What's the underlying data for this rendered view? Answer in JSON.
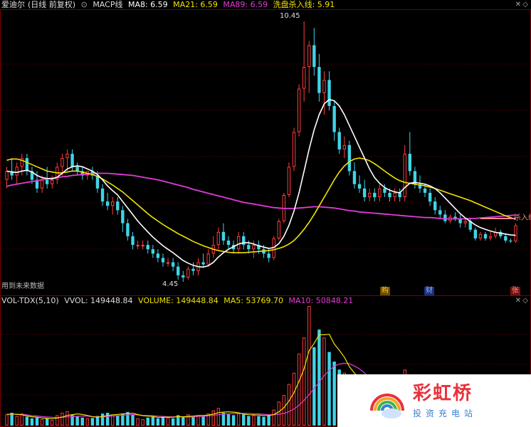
{
  "title": {
    "stock": "爱迪尔",
    "mode": "(日线 前复权)",
    "indicator": "MACP线",
    "ma8_label": "MA8: 6.59",
    "ma21_label": "MA21: 6.59",
    "ma89_label": "MA89: 6.59",
    "wash_label": "洗盘杀入线: 5.91"
  },
  "vol_header": {
    "name": "VOL-TDX(5,10)",
    "vvol": "VVOL: 149448.84",
    "volume": "VOLUME: 149448.84",
    "ma5": "MA5: 53769.70",
    "ma10": "MA10: 50848.21"
  },
  "labels": {
    "high": "10.45",
    "low": "4.45",
    "future_data": "用到未来数据",
    "cross_label": "杀入线"
  },
  "badges": {
    "gou": "购",
    "cai": "财",
    "zhang": "张"
  },
  "watermark": {
    "name": "彩虹桥",
    "sub": "投资充电站"
  },
  "colors": {
    "up": "#ff3c3c",
    "down": "#3fd5e8",
    "ma8": "#ffffff",
    "ma21": "#f2e300",
    "ma89": "#e23bd9",
    "wash": "#ff8a8a",
    "grid": "#7a0000",
    "background": "#000000"
  },
  "chart_data": {
    "type": "candlestick",
    "price_range": [
      4.45,
      10.45
    ],
    "ohlc": [
      [
        6.8,
        7.1,
        6.6,
        7.0
      ],
      [
        7.0,
        7.3,
        6.8,
        6.9
      ],
      [
        6.9,
        7.2,
        6.7,
        7.1
      ],
      [
        7.1,
        7.4,
        6.9,
        7.3
      ],
      [
        7.3,
        7.4,
        6.9,
        7.0
      ],
      [
        7.0,
        7.1,
        6.7,
        6.8
      ],
      [
        6.8,
        7.0,
        6.5,
        6.6
      ],
      [
        6.6,
        6.9,
        6.5,
        6.8
      ],
      [
        6.8,
        7.1,
        6.6,
        6.7
      ],
      [
        6.7,
        6.9,
        6.6,
        6.8
      ],
      [
        6.8,
        7.2,
        6.7,
        7.1
      ],
      [
        7.1,
        7.4,
        6.9,
        7.3
      ],
      [
        7.3,
        7.5,
        7.0,
        7.4
      ],
      [
        7.4,
        7.5,
        7.0,
        7.1
      ],
      [
        7.1,
        7.2,
        6.9,
        7.0
      ],
      [
        7.0,
        7.1,
        6.8,
        6.9
      ],
      [
        6.9,
        7.0,
        6.8,
        7.0
      ],
      [
        7.0,
        7.1,
        6.8,
        6.9
      ],
      [
        6.9,
        7.0,
        6.5,
        6.6
      ],
      [
        6.6,
        6.7,
        6.2,
        6.3
      ],
      [
        6.3,
        6.5,
        6.1,
        6.2
      ],
      [
        6.2,
        6.4,
        6.0,
        6.3
      ],
      [
        6.3,
        6.4,
        6.0,
        6.1
      ],
      [
        6.1,
        6.2,
        5.6,
        5.8
      ],
      [
        5.8,
        5.9,
        5.4,
        5.5
      ],
      [
        5.5,
        5.6,
        5.2,
        5.3
      ],
      [
        5.3,
        5.4,
        5.2,
        5.3
      ],
      [
        5.3,
        5.4,
        5.2,
        5.3
      ],
      [
        5.3,
        5.4,
        5.1,
        5.2
      ],
      [
        5.2,
        5.3,
        5.0,
        5.1
      ],
      [
        5.1,
        5.2,
        4.9,
        5.0
      ],
      [
        5.0,
        5.1,
        4.8,
        4.9
      ],
      [
        4.9,
        5.0,
        4.8,
        4.9
      ],
      [
        4.9,
        5.0,
        4.7,
        4.8
      ],
      [
        4.8,
        4.9,
        4.5,
        4.6
      ],
      [
        4.6,
        4.7,
        4.45,
        4.55
      ],
      [
        4.55,
        4.8,
        4.5,
        4.75
      ],
      [
        4.75,
        4.9,
        4.6,
        4.7
      ],
      [
        4.7,
        5.0,
        4.6,
        4.9
      ],
      [
        4.9,
        5.1,
        4.8,
        4.85
      ],
      [
        4.85,
        5.2,
        4.8,
        5.1
      ],
      [
        5.1,
        5.5,
        5.0,
        5.3
      ],
      [
        5.3,
        5.7,
        5.2,
        5.6
      ],
      [
        5.6,
        5.8,
        5.3,
        5.4
      ],
      [
        5.4,
        5.5,
        5.2,
        5.3
      ],
      [
        5.3,
        5.4,
        5.1,
        5.2
      ],
      [
        5.2,
        5.6,
        5.1,
        5.5
      ],
      [
        5.5,
        5.6,
        5.2,
        5.3
      ],
      [
        5.3,
        5.4,
        5.1,
        5.2
      ],
      [
        5.2,
        5.4,
        5.0,
        5.3
      ],
      [
        5.3,
        5.4,
        5.1,
        5.2
      ],
      [
        5.2,
        5.3,
        5.0,
        5.1
      ],
      [
        5.1,
        5.2,
        4.9,
        5.0
      ],
      [
        5.0,
        5.5,
        4.95,
        5.45
      ],
      [
        5.45,
        5.9,
        5.4,
        5.85
      ],
      [
        5.85,
        6.5,
        5.8,
        6.45
      ],
      [
        6.45,
        7.2,
        6.4,
        7.1
      ],
      [
        7.1,
        8.0,
        7.0,
        7.9
      ],
      [
        7.9,
        9.0,
        7.8,
        8.9
      ],
      [
        8.9,
        10.45,
        8.6,
        9.4
      ],
      [
        9.4,
        10.0,
        8.8,
        9.9
      ],
      [
        9.9,
        10.3,
        9.2,
        9.4
      ],
      [
        9.4,
        9.7,
        8.6,
        8.8
      ],
      [
        8.8,
        9.3,
        8.3,
        9.1
      ],
      [
        9.1,
        9.3,
        8.4,
        8.5
      ],
      [
        8.5,
        8.6,
        7.7,
        7.9
      ],
      [
        7.9,
        8.0,
        7.4,
        7.5
      ],
      [
        7.5,
        7.8,
        7.3,
        7.6
      ],
      [
        7.6,
        7.7,
        6.9,
        7.0
      ],
      [
        7.0,
        7.2,
        6.6,
        6.7
      ],
      [
        6.7,
        6.9,
        6.5,
        6.6
      ],
      [
        6.6,
        6.8,
        6.3,
        6.4
      ],
      [
        6.4,
        6.6,
        6.3,
        6.5
      ],
      [
        6.5,
        6.6,
        6.3,
        6.4
      ],
      [
        6.4,
        6.7,
        6.3,
        6.6
      ],
      [
        6.6,
        6.7,
        6.4,
        6.5
      ],
      [
        6.5,
        6.6,
        6.3,
        6.4
      ],
      [
        6.4,
        6.6,
        6.3,
        6.5
      ],
      [
        6.5,
        6.6,
        6.3,
        6.4
      ],
      [
        6.4,
        7.6,
        6.3,
        7.4
      ],
      [
        7.4,
        7.9,
        6.9,
        7.0
      ],
      [
        7.0,
        7.1,
        6.6,
        6.7
      ],
      [
        6.7,
        6.9,
        6.5,
        6.6
      ],
      [
        6.6,
        6.7,
        6.4,
        6.5
      ],
      [
        6.5,
        6.6,
        6.2,
        6.3
      ],
      [
        6.3,
        6.4,
        6.0,
        6.1
      ],
      [
        6.1,
        6.2,
        5.9,
        6.0
      ],
      [
        6.0,
        6.1,
        5.8,
        5.85
      ],
      [
        5.85,
        6.0,
        5.8,
        5.95
      ],
      [
        5.95,
        6.05,
        5.85,
        5.9
      ],
      [
        5.9,
        6.0,
        5.7,
        5.8
      ],
      [
        5.8,
        5.9,
        5.7,
        5.85
      ],
      [
        5.85,
        5.9,
        5.6,
        5.65
      ],
      [
        5.65,
        5.7,
        5.4,
        5.45
      ],
      [
        5.45,
        5.6,
        5.4,
        5.55
      ],
      [
        5.55,
        5.6,
        5.4,
        5.45
      ],
      [
        5.45,
        5.6,
        5.4,
        5.5
      ],
      [
        5.5,
        5.7,
        5.45,
        5.6
      ],
      [
        5.6,
        5.65,
        5.45,
        5.5
      ],
      [
        5.5,
        5.55,
        5.35,
        5.4
      ],
      [
        5.4,
        5.45,
        5.35,
        5.38
      ],
      [
        5.38,
        5.8,
        5.35,
        5.75
      ]
    ],
    "ma8": [
      7.0,
      6.98,
      6.97,
      7.0,
      7.02,
      6.98,
      6.9,
      6.85,
      6.83,
      6.82,
      6.86,
      6.95,
      7.05,
      7.1,
      7.12,
      7.1,
      7.05,
      7.0,
      6.92,
      6.8,
      6.66,
      6.55,
      6.45,
      6.3,
      6.15,
      6.0,
      5.85,
      5.72,
      5.6,
      5.48,
      5.38,
      5.28,
      5.2,
      5.12,
      5.03,
      4.94,
      4.88,
      4.83,
      4.8,
      4.79,
      4.82,
      4.9,
      5.02,
      5.12,
      5.2,
      5.26,
      5.32,
      5.35,
      5.35,
      5.32,
      5.28,
      5.25,
      5.22,
      5.24,
      5.33,
      5.5,
      5.75,
      6.08,
      6.5,
      7.0,
      7.5,
      7.95,
      8.3,
      8.55,
      8.65,
      8.62,
      8.5,
      8.3,
      8.05,
      7.8,
      7.55,
      7.3,
      7.05,
      6.85,
      6.72,
      6.62,
      6.56,
      6.52,
      6.5,
      6.62,
      6.72,
      6.74,
      6.72,
      6.7,
      6.66,
      6.6,
      6.5,
      6.38,
      6.26,
      6.14,
      6.02,
      5.92,
      5.84,
      5.76,
      5.7,
      5.66,
      5.62,
      5.59,
      5.57,
      5.55,
      5.53,
      5.52
    ],
    "ma21": [
      7.25,
      7.28,
      7.28,
      7.25,
      7.2,
      7.15,
      7.1,
      7.05,
      7.0,
      6.98,
      6.96,
      6.96,
      6.98,
      7.0,
      7.0,
      6.98,
      6.95,
      6.92,
      6.88,
      6.82,
      6.75,
      6.68,
      6.6,
      6.52,
      6.42,
      6.32,
      6.22,
      6.12,
      6.02,
      5.93,
      5.85,
      5.77,
      5.7,
      5.63,
      5.56,
      5.5,
      5.44,
      5.38,
      5.33,
      5.28,
      5.24,
      5.2,
      5.17,
      5.15,
      5.13,
      5.12,
      5.12,
      5.12,
      5.13,
      5.14,
      5.15,
      5.16,
      5.17,
      5.19,
      5.22,
      5.26,
      5.32,
      5.4,
      5.52,
      5.66,
      5.82,
      6.0,
      6.2,
      6.4,
      6.6,
      6.8,
      6.98,
      7.12,
      7.22,
      7.28,
      7.3,
      7.28,
      7.24,
      7.17,
      7.09,
      7.0,
      6.92,
      6.84,
      6.78,
      6.74,
      6.72,
      6.7,
      6.68,
      6.66,
      6.63,
      6.6,
      6.56,
      6.52,
      6.48,
      6.44,
      6.4,
      6.36,
      6.32,
      6.27,
      6.22,
      6.17,
      6.12,
      6.07,
      6.02,
      5.97,
      5.93,
      5.89
    ],
    "ma89": [
      6.65,
      6.68,
      6.7,
      6.72,
      6.74,
      6.76,
      6.78,
      6.8,
      6.82,
      6.84,
      6.85,
      6.87,
      6.88,
      6.9,
      6.91,
      6.92,
      6.93,
      6.94,
      6.95,
      6.95,
      6.95,
      6.94,
      6.93,
      6.92,
      6.91,
      6.9,
      6.88,
      6.86,
      6.84,
      6.82,
      6.8,
      6.77,
      6.74,
      6.71,
      6.68,
      6.65,
      6.62,
      6.58,
      6.55,
      6.52,
      6.49,
      6.46,
      6.43,
      6.4,
      6.37,
      6.34,
      6.31,
      6.28,
      6.26,
      6.24,
      6.22,
      6.2,
      6.18,
      6.16,
      6.15,
      6.14,
      6.14,
      6.14,
      6.15,
      6.16,
      6.17,
      6.18,
      6.18,
      6.17,
      6.16,
      6.15,
      6.13,
      6.11,
      6.09,
      6.08,
      6.06,
      6.05,
      6.04,
      6.03,
      6.02,
      6.01,
      6.0,
      5.99,
      5.98,
      5.97,
      5.96,
      5.95,
      5.94,
      5.93,
      5.93,
      5.92,
      5.91,
      5.9,
      5.9,
      5.9,
      5.9,
      5.9,
      5.91,
      5.91,
      5.92,
      5.93,
      5.94,
      5.95,
      5.96,
      5.97,
      5.98,
      5.99
    ],
    "wash_line": 5.91,
    "volume_max": 149448.84,
    "volume": [
      14000,
      16000,
      12000,
      15000,
      11000,
      9000,
      10000,
      8000,
      9000,
      7000,
      13000,
      16000,
      18000,
      14000,
      12000,
      10000,
      9000,
      9500,
      12000,
      15000,
      16000,
      14000,
      13000,
      15000,
      17000,
      14000,
      9000,
      8000,
      10000,
      11000,
      9000,
      12000,
      10000,
      9000,
      13000,
      11000,
      14000,
      12000,
      13000,
      12000,
      15000,
      19000,
      22000,
      16000,
      14000,
      13000,
      15000,
      14000,
      12000,
      13000,
      12000,
      11000,
      13000,
      20000,
      30000,
      38000,
      52000,
      66000,
      90000,
      110000,
      149448.84,
      98000,
      120000,
      110000,
      92000,
      80000,
      70000,
      66000,
      60000,
      52000,
      46000,
      40000,
      36000,
      30000,
      30000,
      24000,
      26000,
      22000,
      20000,
      70000,
      64000,
      42000,
      36000,
      30000,
      28000,
      26000,
      24000,
      22000,
      20000,
      18000,
      16000,
      14000,
      15000,
      16000,
      13000,
      12000,
      14000,
      12000,
      11000,
      10000,
      12000,
      24000
    ],
    "vol_ma5": [
      14000,
      14500,
      14000,
      13500,
      12000,
      11000,
      10500,
      9500,
      9000,
      8600,
      9400,
      10600,
      12600,
      13600,
      14600,
      14000,
      12600,
      11100,
      10500,
      11300,
      12500,
      13300,
      14000,
      14600,
      15000,
      15400,
      13800,
      12400,
      11800,
      11400,
      10200,
      10400,
      10600,
      10400,
      11400,
      11000,
      11500,
      11800,
      12600,
      12600,
      13200,
      14200,
      16200,
      16800,
      17200,
      16800,
      16000,
      14400,
      13600,
      13400,
      13200,
      12600,
      12600,
      13800,
      17200,
      22400,
      30600,
      41200,
      55200,
      71200,
      93700,
      102700,
      113500,
      113500,
      114100,
      102000,
      94000,
      85600,
      73600,
      65600,
      58800,
      52800,
      47600,
      41600,
      36800,
      32000,
      29200,
      26400,
      24400,
      34400,
      40400,
      43600,
      46400,
      48400,
      36000,
      32400,
      28800,
      26000,
      24000,
      22000,
      20000,
      18000,
      17000,
      15800,
      14800,
      14000,
      14000,
      13400,
      12600,
      11800,
      11800,
      13800
    ],
    "vol_ma10": [
      14000,
      14200,
      14200,
      14000,
      13400,
      12400,
      12000,
      11200,
      10800,
      10300,
      10000,
      10300,
      10900,
      11200,
      11600,
      12000,
      11800,
      11100,
      10900,
      11000,
      11200,
      11800,
      12400,
      12900,
      13300,
      13700,
      13300,
      12700,
      12600,
      12400,
      11800,
      11400,
      11000,
      10900,
      11000,
      10800,
      10700,
      11000,
      11400,
      11600,
      12100,
      12700,
      13600,
      14200,
      14700,
      15000,
      15100,
      15300,
      15200,
      14900,
      14700,
      14100,
      13600,
      13600,
      14200,
      15200,
      17400,
      20600,
      25400,
      31800,
      38600,
      46600,
      54200,
      62600,
      68800,
      74500,
      76900,
      77900,
      77400,
      74500,
      70800,
      66000,
      57300,
      51200,
      44800,
      39300,
      35200,
      30700,
      26600,
      28100,
      29500,
      29700,
      30300,
      30600,
      30600,
      30800,
      30000,
      25900,
      22800,
      21000,
      19400,
      17800,
      16600,
      15200,
      13900,
      13800,
      13300,
      12600,
      12000,
      11900,
      11800,
      12300
    ]
  }
}
